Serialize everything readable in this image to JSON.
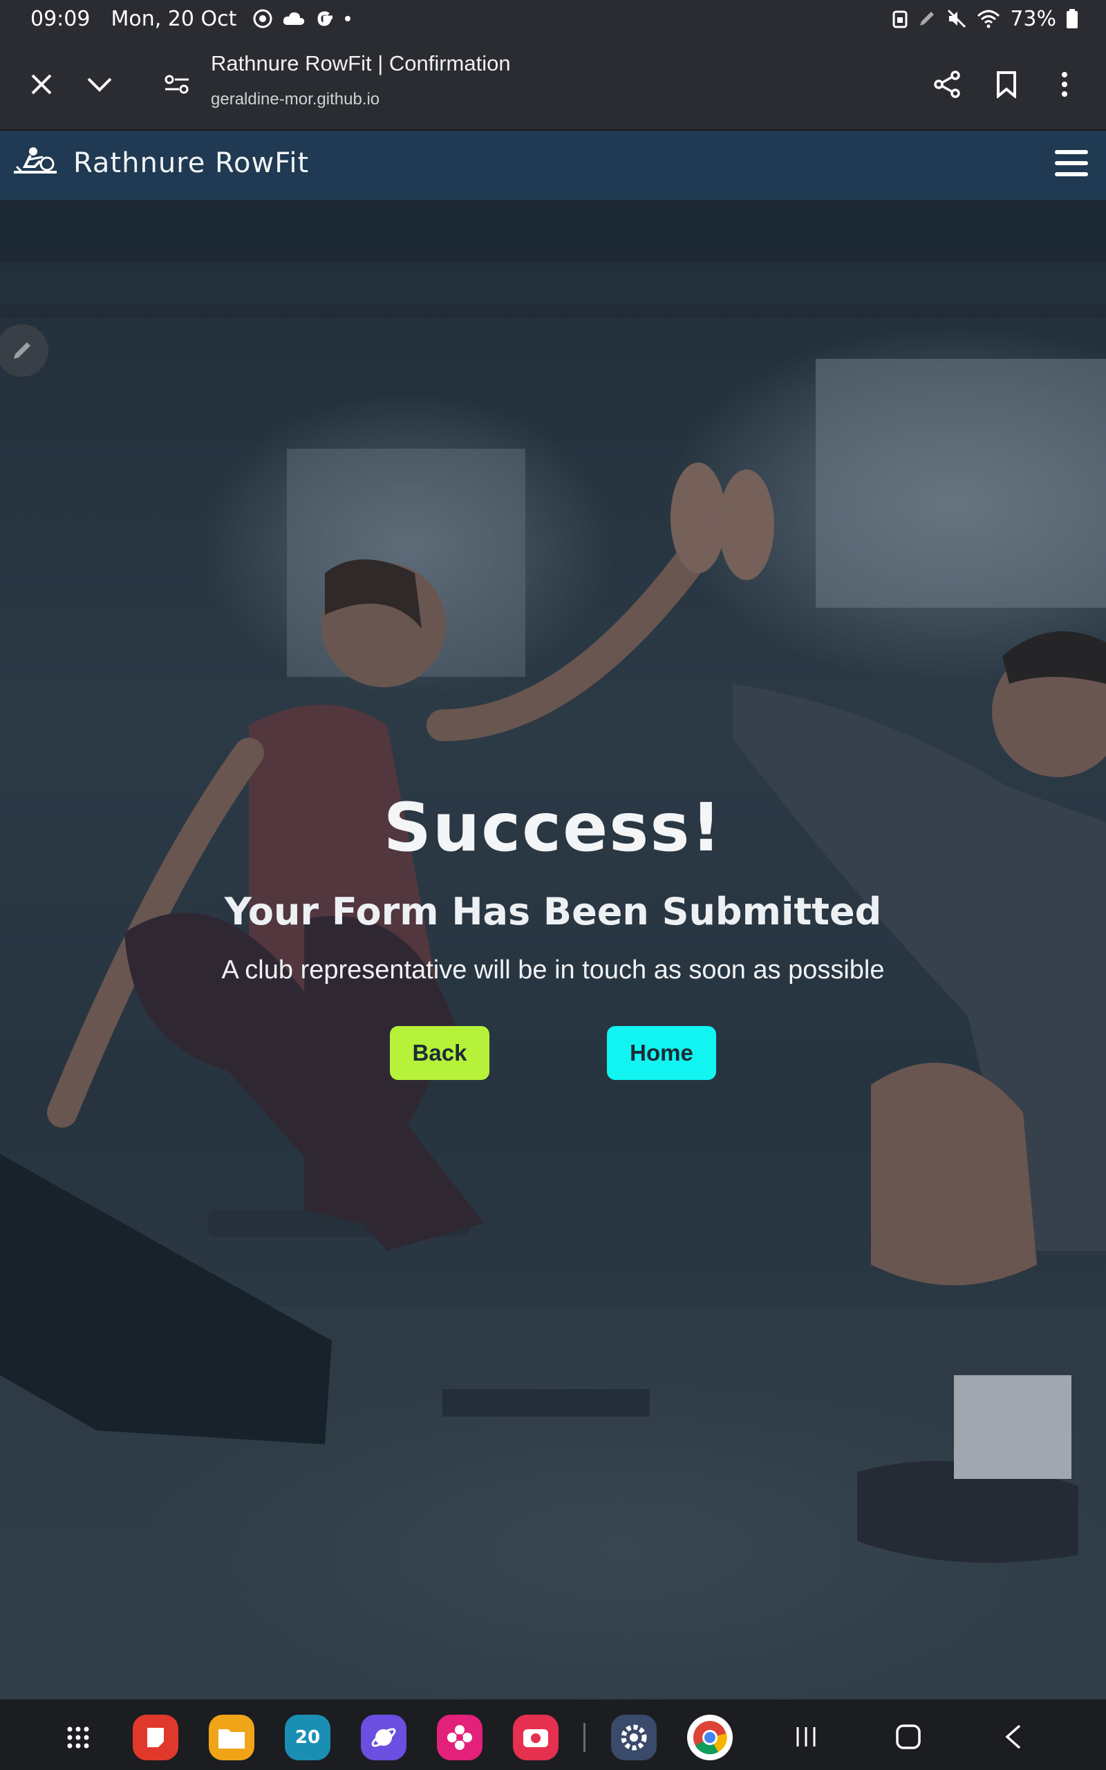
{
  "status_bar": {
    "time": "09:09",
    "date": "Mon, 20 Oct",
    "battery": "73%"
  },
  "browser": {
    "page_title": "Rathnure RowFit | Confirmation",
    "url": "geraldine-mor.github.io"
  },
  "site": {
    "brand": "Rathnure RowFit"
  },
  "hero": {
    "heading": "Success!",
    "subheading": "Your Form Has Been Submitted",
    "message": "A club representative will be in touch as soon as possible",
    "back_label": "Back",
    "home_label": "Home"
  },
  "dock": {
    "calendar_day": "20"
  },
  "colors": {
    "nav_background": "#1f3a52",
    "back_button": "#b6f23a",
    "home_button": "#12f4f2"
  }
}
